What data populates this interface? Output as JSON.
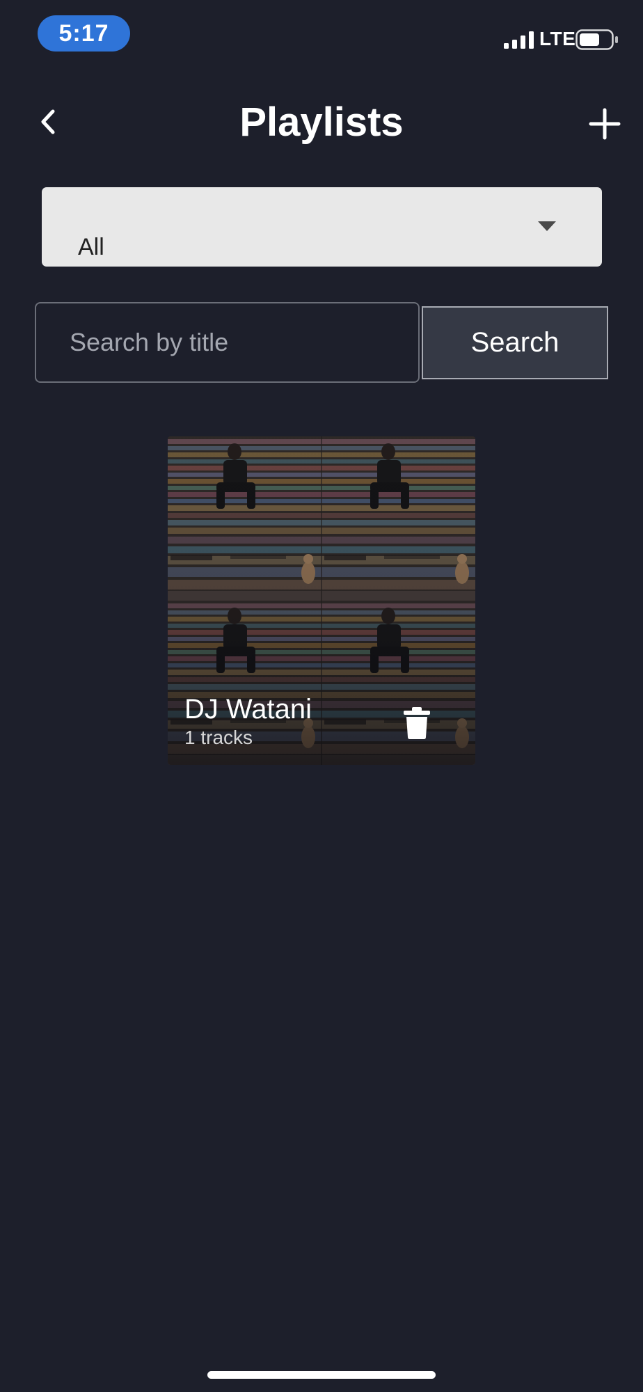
{
  "status_bar": {
    "time": "5:17",
    "network": "LTE",
    "signal_icon": "cellular-signal-icon",
    "battery_icon": "battery-icon",
    "battery_level": 0.62
  },
  "header": {
    "title": "Playlists",
    "back_icon": "chevron-left-icon",
    "add_icon": "plus-icon"
  },
  "filter": {
    "selected": "All",
    "caret_icon": "caret-down-icon"
  },
  "search": {
    "placeholder": "Search by title",
    "value": "",
    "button_label": "Search"
  },
  "playlists": [
    {
      "title": "DJ Watani",
      "tracks": "1 tracks",
      "delete_icon": "trash-icon"
    }
  ],
  "colors": {
    "background": "#1d1f2b",
    "time_pill": "#2f74d8",
    "select_bg": "#e8e8e8",
    "search_button_bg": "#353945"
  }
}
